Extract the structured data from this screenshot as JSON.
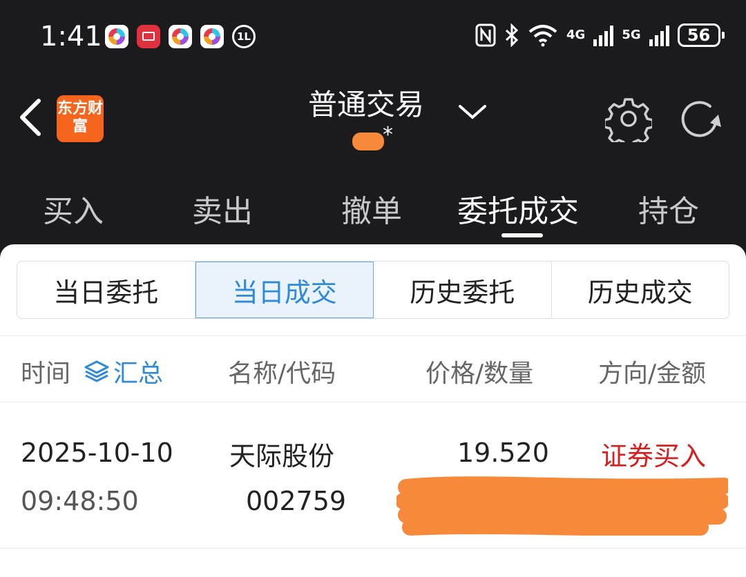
{
  "status_bar": {
    "time": "1:41",
    "notification_icons": [
      "app-icon",
      "red-book-icon",
      "app-icon",
      "app-icon",
      "circle-badge-icon"
    ],
    "circle_badge_text": "1L",
    "network_4g": "4G",
    "network_5g": "5G",
    "battery": "56"
  },
  "header": {
    "logo_text": "东方财富",
    "title": "普通交易",
    "account_suffix": "*"
  },
  "main_tabs": [
    {
      "label": "买入"
    },
    {
      "label": "卖出"
    },
    {
      "label": "撤单"
    },
    {
      "label": "委托成交"
    },
    {
      "label": "持仓"
    }
  ],
  "sub_tabs": [
    {
      "label": "当日委托"
    },
    {
      "label": "当日成交"
    },
    {
      "label": "历史委托"
    },
    {
      "label": "历史成交"
    }
  ],
  "table": {
    "headers": {
      "time": "时间",
      "summary": "汇总",
      "name_code": "名称/代码",
      "price_qty": "价格/数量",
      "direction_amount": "方向/金额"
    },
    "rows": [
      {
        "date": "2025-10-10",
        "time": "09:48:50",
        "name": "天际股份",
        "code": "002759",
        "price": "19.520",
        "direction": "证券买入"
      }
    ]
  },
  "colors": {
    "accent_blue": "#2f8ad8",
    "buy_red": "#d81e1e",
    "logo_orange": "#f5651d",
    "header_dark": "#1b1b1d"
  }
}
